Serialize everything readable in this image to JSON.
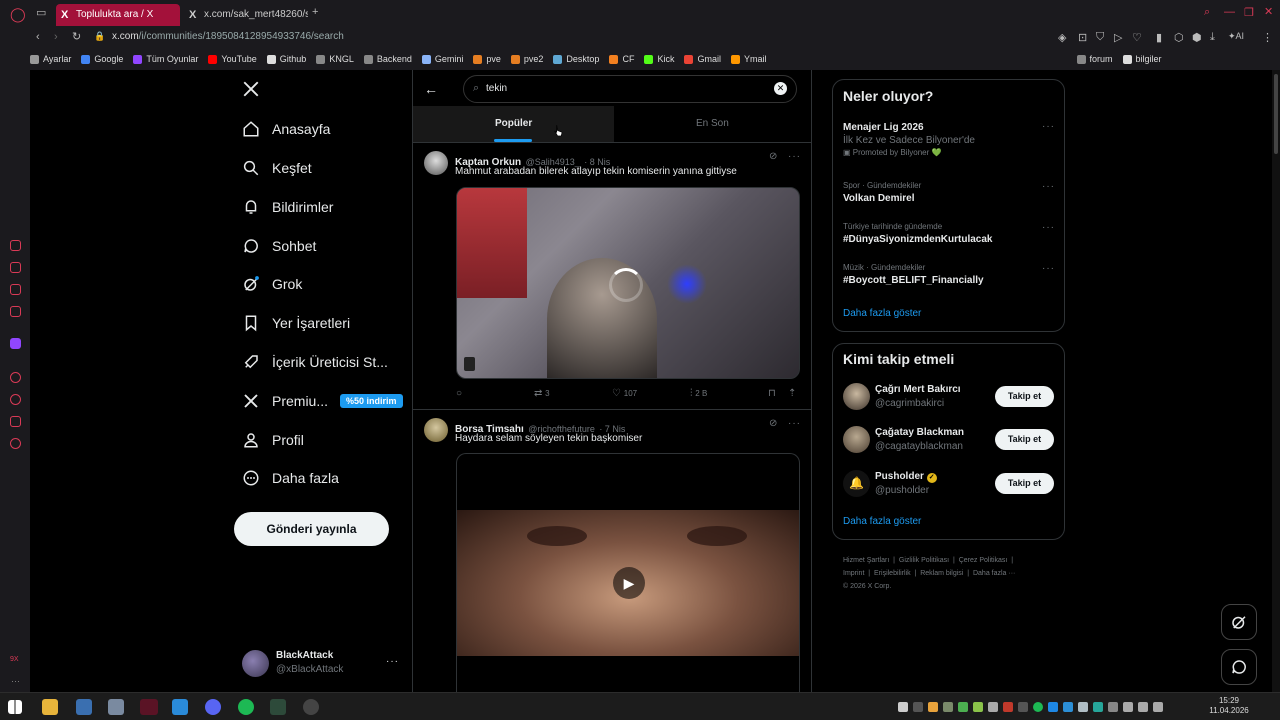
{
  "browser": {
    "tabs": [
      {
        "label": "Toplulukta ara / X"
      },
      {
        "label": "x.com/sak_mert48260/sta"
      }
    ],
    "new_tab": "+",
    "url_host": "x.com",
    "url_path": "/i/communities/1895084128954933746/search",
    "bookmarks": [
      "Ayarlar",
      "Google",
      "Tüm Oyunlar",
      "YouTube",
      "Github",
      "KNGL",
      "Backend",
      "Gemini",
      "pve",
      "pve2",
      "Desktop",
      "CF",
      "Kick",
      "Gmail",
      "Ymail",
      "forum",
      "bilgiler"
    ],
    "ai_label": "AI"
  },
  "nav": {
    "logo": "X",
    "items": [
      {
        "label": "Anasayfa"
      },
      {
        "label": "Keşfet"
      },
      {
        "label": "Bildirimler"
      },
      {
        "label": "Sohbet"
      },
      {
        "label": "Grok"
      },
      {
        "label": "Yer İşaretleri"
      },
      {
        "label": "İçerik Üreticisi St..."
      },
      {
        "label": "Premiu..."
      },
      {
        "label": "Profil"
      },
      {
        "label": "Daha fazla"
      }
    ],
    "premium_badge": "%50 indirim",
    "post_button": "Gönderi yayınla",
    "account": {
      "name": "BlackAttack",
      "handle": "@xBlackAttack"
    }
  },
  "search": {
    "query": "tekin",
    "tabs": [
      "Popüler",
      "En Son"
    ]
  },
  "tweets": [
    {
      "name": "Kaptan Orkun",
      "handle": "@Salih4913_",
      "time": "· 8 Nis",
      "text": "Mahmut arabadan bilerek atlayıp tekin komiserin yanına gittiyse",
      "retweets": "3",
      "likes": "107",
      "views": "2 B"
    },
    {
      "name": "Borsa Timsahı",
      "handle": "@richofthefuture",
      "time": "· 7 Nis",
      "text": "Haydara selam söyleyen tekin başkomiser"
    }
  ],
  "trends": {
    "title": "Neler oluyor?",
    "items": [
      {
        "meta": "",
        "title": "Menajer Lig 2026",
        "sub": "İlk Kez ve Sadece Bilyoner'de",
        "promo": "Promoted by Bilyoner 💚"
      },
      {
        "meta": "Spor · Gündemdekiler",
        "title": "Volkan Demirel"
      },
      {
        "meta": "Türkiye tarihinde gündemde",
        "title": "#DünyaSiyonizmdenKurtulacak"
      },
      {
        "meta": "Müzik · Gündemdekiler",
        "title": "#Boycott_BELIFT_Financially"
      }
    ],
    "more": "Daha fazla göster"
  },
  "who_to_follow": {
    "title": "Kimi takip etmeli",
    "users": [
      {
        "name": "Çağrı Mert Bakırcı",
        "handle": "@cagrimbakirci",
        "button": "Takip et"
      },
      {
        "name": "Çağatay Blackman",
        "handle": "@cagatayblackman",
        "button": "Takip et"
      },
      {
        "name": "Pusholder",
        "handle": "@pusholder",
        "button": "Takip et"
      }
    ],
    "more": "Daha fazla göster"
  },
  "footer": {
    "links": [
      "Hizmet Şartları",
      "Gizlilik Politikası",
      "Çerez Politikası",
      "Imprint",
      "Erişilebilirlik",
      "Reklam bilgisi",
      "Daha fazla ···"
    ],
    "copyright": "© 2026 X Corp."
  },
  "taskbar": {
    "time": "15:29",
    "date": "11.04.2026"
  },
  "colors": {
    "accent": "#1d9bf0",
    "tab_active": "#a3113a",
    "background": "#000000"
  }
}
